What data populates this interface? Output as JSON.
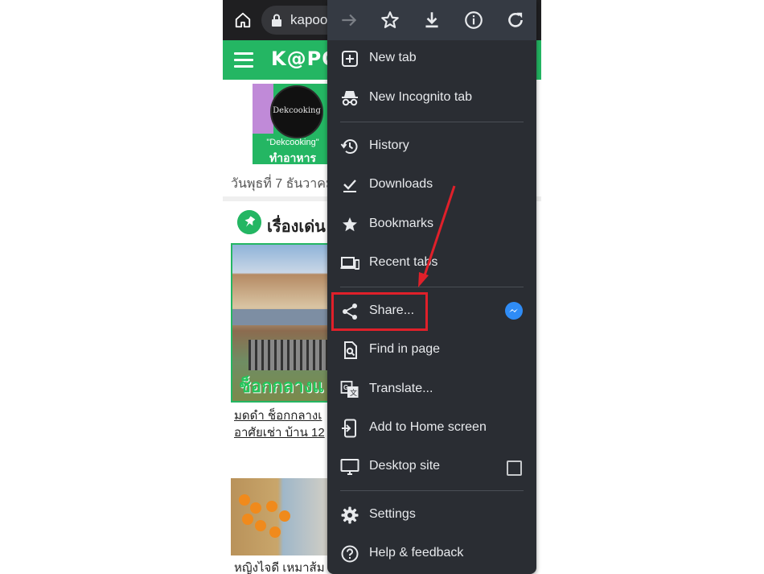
{
  "browser": {
    "url_text": "kapoo"
  },
  "site": {
    "logo_text": "K@PO",
    "ad": {
      "circle_text": "Dekcooking",
      "line1": "\"Dekcooking\"",
      "line2": "ทำอาหาร"
    },
    "date_text": "วันพุธที่ 7 ธันวาคม",
    "section_title": "เรื่องเด่น",
    "photo1_caption": "ช็อกกลางแ",
    "article1_line1": "มดดำ ช็อกกลางเ",
    "article1_line2": "อาศัยเช่า บ้าน 12",
    "article2_title": "หญิงไจดี เหมาส้ม"
  },
  "menu": {
    "toolbar": [
      "forward-icon",
      "star-icon",
      "download-icon",
      "info-icon",
      "refresh-icon"
    ],
    "items": [
      {
        "label": "New tab",
        "icon": "new-tab-icon"
      },
      {
        "label": "New Incognito tab",
        "icon": "incognito-icon"
      },
      {
        "label": "History",
        "icon": "history-icon"
      },
      {
        "label": "Downloads",
        "icon": "downloads-icon"
      },
      {
        "label": "Bookmarks",
        "icon": "bookmarks-star-icon"
      },
      {
        "label": "Recent tabs",
        "icon": "recent-tabs-icon"
      },
      {
        "label": "Share...",
        "icon": "share-icon"
      },
      {
        "label": "Find in page",
        "icon": "find-in-page-icon"
      },
      {
        "label": "Translate...",
        "icon": "translate-icon"
      },
      {
        "label": "Add to Home screen",
        "icon": "add-to-home-icon"
      },
      {
        "label": "Desktop site",
        "icon": "desktop-icon"
      },
      {
        "label": "Settings",
        "icon": "settings-gear-icon"
      },
      {
        "label": "Help & feedback",
        "icon": "help-icon"
      }
    ],
    "desktop_site_checked": false
  },
  "colors": {
    "menu_bg": "#2a2d33",
    "site_green": "#24b663",
    "annotation_red": "#e0202a",
    "messenger_blue": "#2f8cf6"
  }
}
